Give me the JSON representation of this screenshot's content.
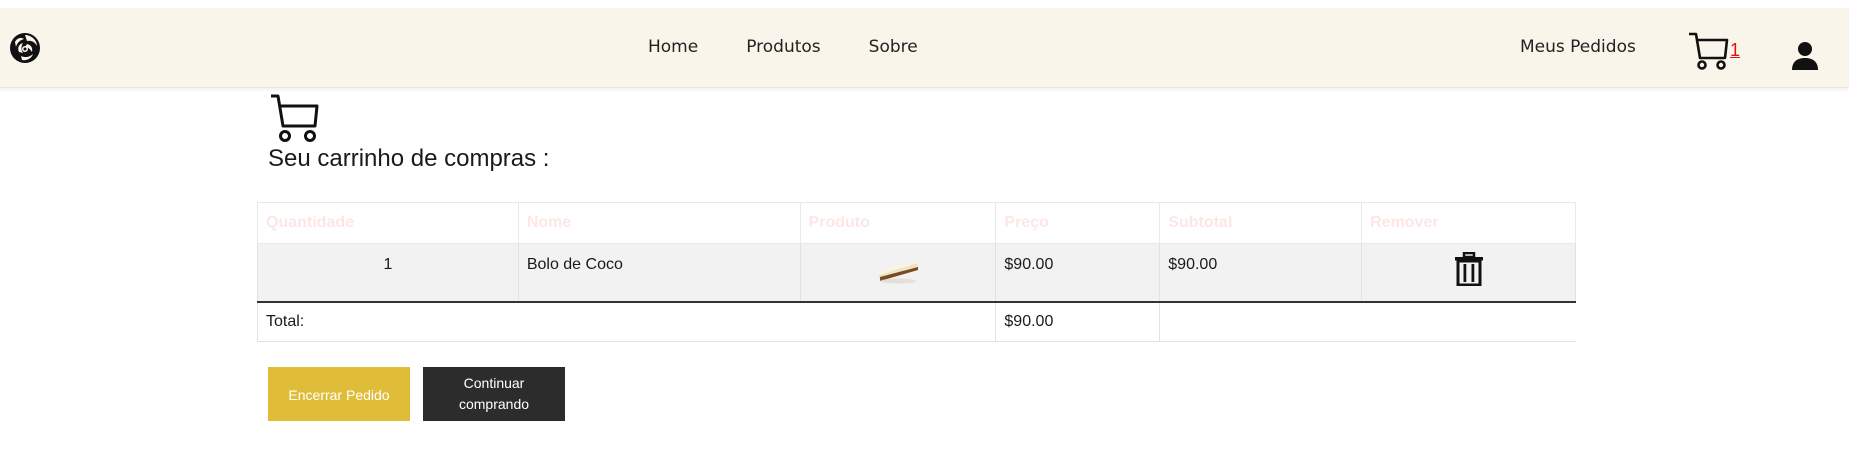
{
  "nav": {
    "links": [
      "Home",
      "Produtos",
      "Sobre"
    ],
    "orders_label": "Meus Pedidos",
    "cart_count": "1",
    "logo_icon": "rose-logo-icon",
    "cart_icon": "cart-icon",
    "user_icon": "user-icon"
  },
  "cart": {
    "title": "Seu carrinho de compras :",
    "headers": [
      "Quantidade",
      "Nome",
      "Produto",
      "Preço",
      "Subtotal",
      "Remover"
    ],
    "items": [
      {
        "quantity": "1",
        "name": "Bolo de Coco",
        "image_icon": "coconut-cake-image",
        "price": "$90.00",
        "subtotal": "$90.00",
        "remove_icon": "trash-icon"
      }
    ],
    "total_label": "Total:",
    "total_value": "$90.00"
  },
  "actions": {
    "finish_label": "Encerrar Pedido",
    "continue_label": "Continuar comprando"
  },
  "colors": {
    "navbar_bg": "#faf5ea",
    "header_text": "#fde6e6",
    "finish_btn": "#e0bd39",
    "continue_btn": "#2c2c2c",
    "cart_count": "#e01010"
  }
}
